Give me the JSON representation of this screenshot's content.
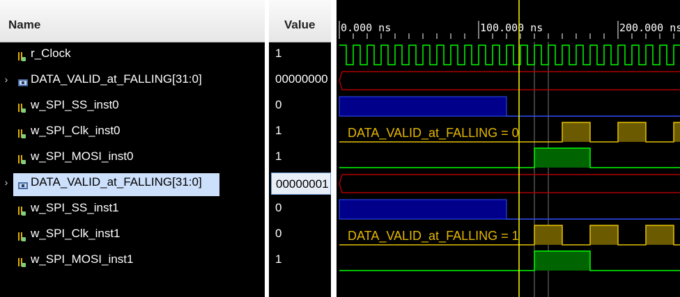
{
  "columns": {
    "name": "Name",
    "value": "Value"
  },
  "rows": [
    {
      "name": "r_Clock",
      "value": "1",
      "bus": false,
      "expanded": false
    },
    {
      "name": "DATA_VALID_at_FALLING[31:0]",
      "value": "00000000",
      "bus": true,
      "expanded": false
    },
    {
      "name": "w_SPI_SS_inst0",
      "value": "0",
      "bus": false
    },
    {
      "name": "w_SPI_Clk_inst0",
      "value": "1",
      "bus": false
    },
    {
      "name": "w_SPI_MOSI_inst0",
      "value": "1",
      "bus": false
    },
    {
      "name": "DATA_VALID_at_FALLING[31:0]",
      "value": "00000001",
      "bus": true,
      "expanded": false,
      "selected": true
    },
    {
      "name": "w_SPI_SS_inst1",
      "value": "0",
      "bus": false
    },
    {
      "name": "w_SPI_Clk_inst1",
      "value": "0",
      "bus": false
    },
    {
      "name": "w_SPI_MOSI_inst1",
      "value": "1",
      "bus": false
    }
  ],
  "timeline": {
    "ticks": [
      {
        "time_ns": 0,
        "label": "0.000 ns"
      },
      {
        "time_ns": 100,
        "label": "100.000 ns"
      },
      {
        "time_ns": 200,
        "label": "200.000 ns"
      }
    ],
    "cursor_ns": 129
  },
  "annotations": [
    {
      "text": "DATA_VALID_at_FALLING = 0",
      "row": 3
    },
    {
      "text": "DATA_VALID_at_FALLING = 1",
      "row": 7
    }
  ],
  "colors": {
    "clock": "#00ff00",
    "bus_outline": "#b00000",
    "ss_fill": "#00008b",
    "ss_line": "#3050ff",
    "spi_clk_line": "#e6c300",
    "spi_clk_fill": "#6b5a00",
    "mosi_line": "#00ff00",
    "mosi_fill": "#006400",
    "cursor": "#ffff00",
    "annotation": "#e6b800",
    "grid": "#7a7a7a"
  }
}
